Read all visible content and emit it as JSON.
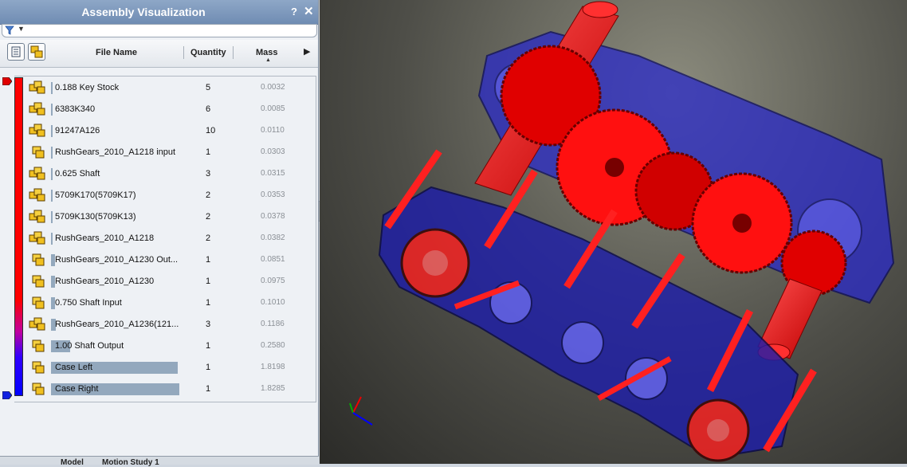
{
  "window": {
    "title": "Assembly Visualization",
    "help_label": "?",
    "close_label": "✕"
  },
  "filter": {
    "icon": "funnel-icon",
    "caret": "▼"
  },
  "columns": {
    "file_name": "File Name",
    "quantity": "Quantity",
    "mass": "Mass",
    "sort_indicator": "▲",
    "scroll_right": "▶"
  },
  "rows": [
    {
      "name": "0.188 Key Stock",
      "qty": "5",
      "mass": "0.0032",
      "icon": "multi-part-icon",
      "bar_fraction": 0.0
    },
    {
      "name": "6383K340",
      "qty": "6",
      "mass": "0.0085",
      "icon": "multi-part-icon",
      "bar_fraction": 0.0
    },
    {
      "name": "91247A126",
      "qty": "10",
      "mass": "0.0110",
      "icon": "multi-part-icon",
      "bar_fraction": 0.0
    },
    {
      "name": "RushGears_2010_A1218 input",
      "qty": "1",
      "mass": "0.0303",
      "icon": "part-icon",
      "bar_fraction": 0.01
    },
    {
      "name": "0.625 Shaft",
      "qty": "3",
      "mass": "0.0315",
      "icon": "multi-part-icon",
      "bar_fraction": 0.0
    },
    {
      "name": "5709K170(5709K17)",
      "qty": "2",
      "mass": "0.0353",
      "icon": "multi-part-icon",
      "bar_fraction": 0.0
    },
    {
      "name": "5709K130(5709K13)",
      "qty": "2",
      "mass": "0.0378",
      "icon": "multi-part-icon",
      "bar_fraction": 0.0
    },
    {
      "name": "RushGears_2010_A1218",
      "qty": "2",
      "mass": "0.0382",
      "icon": "multi-part-icon",
      "bar_fraction": 0.0
    },
    {
      "name": "RushGears_2010_A1230 Out...",
      "qty": "1",
      "mass": "0.0851",
      "icon": "part-icon",
      "bar_fraction": 0.03
    },
    {
      "name": "RushGears_2010_A1230",
      "qty": "1",
      "mass": "0.0975",
      "icon": "part-icon",
      "bar_fraction": 0.03
    },
    {
      "name": "0.750 Shaft Input",
      "qty": "1",
      "mass": "0.1010",
      "icon": "part-icon",
      "bar_fraction": 0.03
    },
    {
      "name": "RushGears_2010_A1236(121...",
      "qty": "3",
      "mass": "0.1186",
      "icon": "multi-part-icon",
      "bar_fraction": 0.04
    },
    {
      "name": "1.00 Shaft Output",
      "qty": "1",
      "mass": "0.2580",
      "icon": "part-icon",
      "bar_fraction": 0.15
    },
    {
      "name": "Case Left",
      "qty": "1",
      "mass": "1.8198",
      "icon": "part-icon",
      "bar_fraction": 0.99
    },
    {
      "name": "Case Right",
      "qty": "1",
      "mass": "1.8285",
      "icon": "part-icon",
      "bar_fraction": 1.0
    }
  ],
  "tabs": [
    "Model",
    "Motion Study 1"
  ],
  "colors": {
    "high": "#ff0000",
    "low": "#0000ff",
    "bar": "#93a8bd",
    "panel": "#eef1f5"
  }
}
